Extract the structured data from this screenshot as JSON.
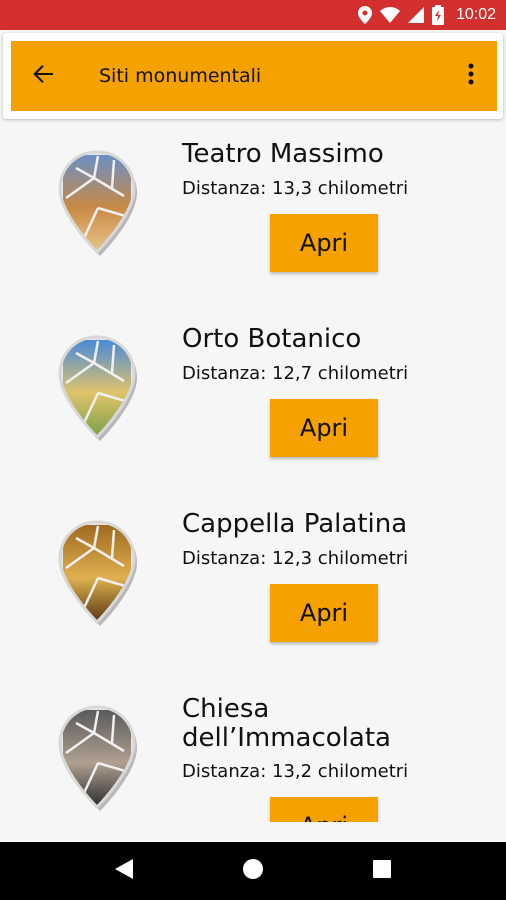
{
  "status_bar": {
    "time": "10:02"
  },
  "toolbar": {
    "title": "Siti monumentali"
  },
  "items": [
    {
      "title": "Teatro Massimo",
      "distance": "Distanza: 13,3 chilometri",
      "button": "Apri",
      "palette": [
        "#6a8fc4",
        "#c98a45",
        "#e8c48a"
      ]
    },
    {
      "title": "Orto Botanico",
      "distance": "Distanza: 12,7 chilometri",
      "button": "Apri",
      "palette": [
        "#4a8ad8",
        "#e0c36a",
        "#7ca04a"
      ]
    },
    {
      "title": "Cappella Palatina",
      "distance": "Distanza: 12,3 chilometri",
      "button": "Apri",
      "palette": [
        "#a06a1e",
        "#e0b050",
        "#5a3a12"
      ]
    },
    {
      "title": "Chiesa dell’Immacolata",
      "distance": "Distanza: 13,2 chilometri",
      "button": "Apri",
      "palette": [
        "#5a5a5a",
        "#b0a090",
        "#2e2e2e"
      ]
    }
  ],
  "colors": {
    "accent": "#f5a100",
    "status_bar": "#d32f2f"
  }
}
